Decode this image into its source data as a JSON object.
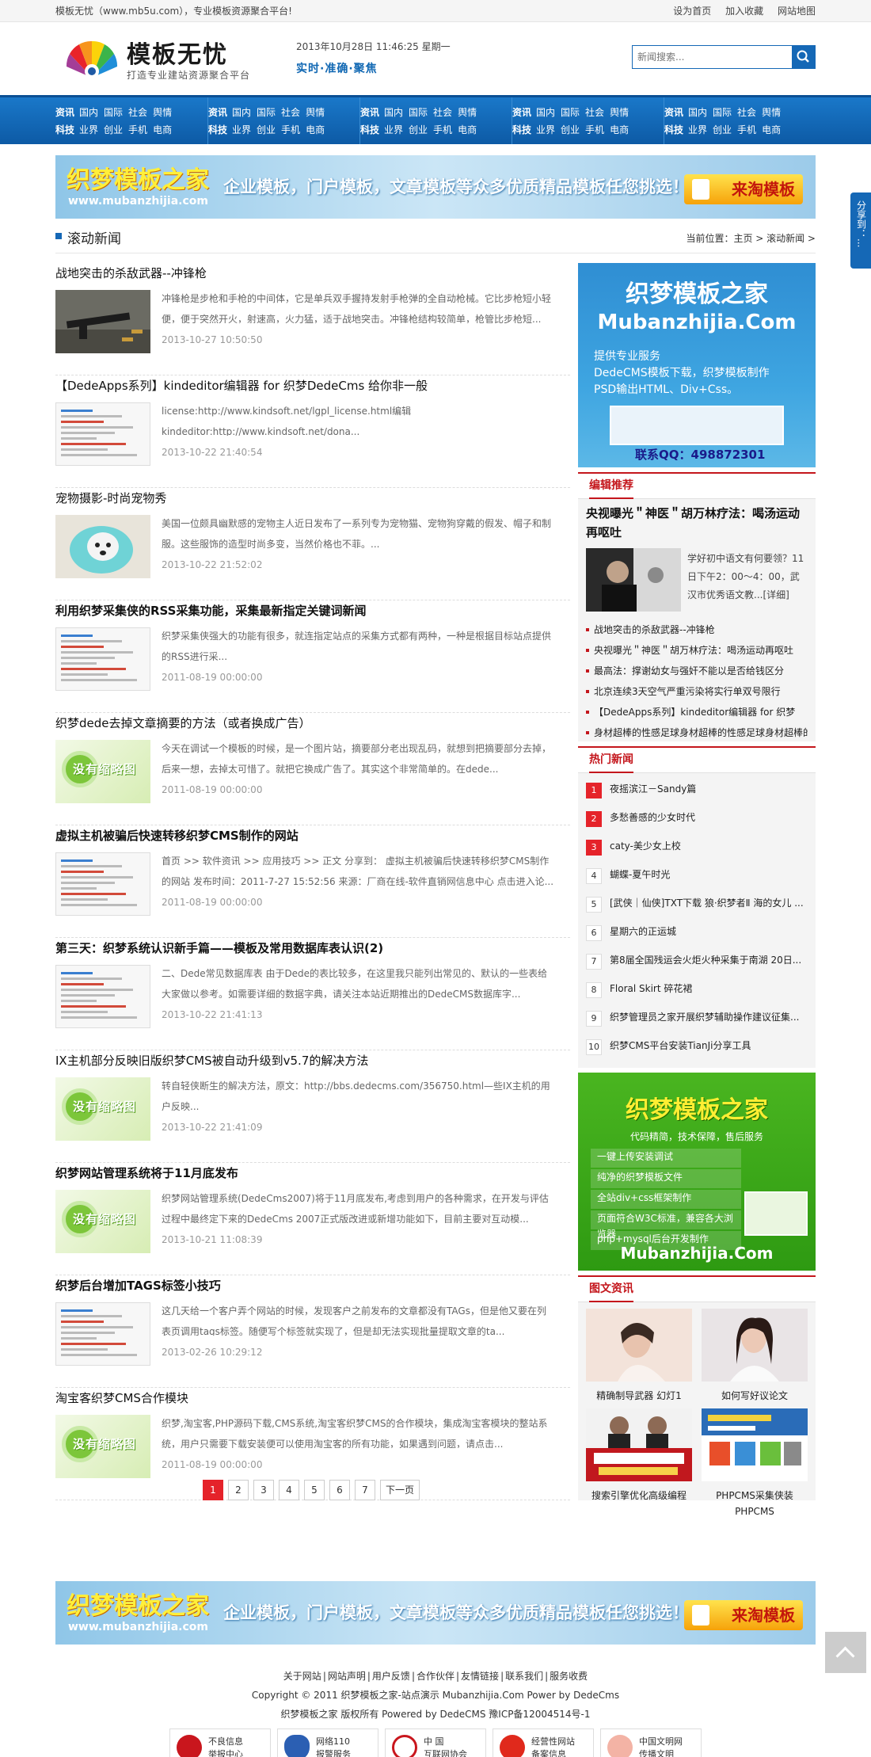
{
  "topbar": {
    "welcome": "模板无忧（www.mb5u.com），专业模板资源聚合平台!",
    "links": [
      "设为首页",
      "加入收藏",
      "网站地图"
    ]
  },
  "header": {
    "logo_name": "模板无忧",
    "logo_slogan": "打造专业建站资源聚合平台",
    "date": "2013年10月28日 11:46:25 星期一",
    "motto": "实时·准确·聚焦",
    "search_placeholder": "新闻搜索..."
  },
  "nav": {
    "columns": [
      {
        "row1_title": "资讯",
        "row1": [
          "国内",
          "国际",
          "社会",
          "舆情"
        ],
        "row2_title": "科技",
        "row2": [
          "业界",
          "创业",
          "手机",
          "电商"
        ]
      },
      {
        "row1_title": "资讯",
        "row1": [
          "国内",
          "国际",
          "社会",
          "舆情"
        ],
        "row2_title": "科技",
        "row2": [
          "业界",
          "创业",
          "手机",
          "电商"
        ]
      },
      {
        "row1_title": "资讯",
        "row1": [
          "国内",
          "国际",
          "社会",
          "舆情"
        ],
        "row2_title": "科技",
        "row2": [
          "业界",
          "创业",
          "手机",
          "电商"
        ]
      },
      {
        "row1_title": "资讯",
        "row1": [
          "国内",
          "国际",
          "社会",
          "舆情"
        ],
        "row2_title": "科技",
        "row2": [
          "业界",
          "创业",
          "手机",
          "电商"
        ]
      },
      {
        "row1_title": "资讯",
        "row1": [
          "国内",
          "国际",
          "社会",
          "舆情"
        ],
        "row2_title": "科技",
        "row2": [
          "业界",
          "创业",
          "手机",
          "电商"
        ]
      }
    ]
  },
  "banner": {
    "logo": "织梦模板之家",
    "url": "www.mubanzhijia.com",
    "text": "企业模板，门户模板，文章模板等众多优质精品模板任您挑选！",
    "button": "来淘模板"
  },
  "crumb": {
    "title": "滚动新闻",
    "position": "当前位置：主页 > 滚动新闻 >"
  },
  "articles": [
    {
      "title": "战地突击的杀敌武器--冲锋枪",
      "desc": "冲锋枪是步枪和手枪的中间体，它是单兵双手握持发射手枪弹的全自动枪械。它比步枪短小轻便，便于突然开火，射速高，火力猛，适于战地突击。冲锋枪结构较简单，枪管比步枪短...",
      "date": "2013-10-27 10:50:50",
      "thumb": "gun"
    },
    {
      "title": "【DedeApps系列】kindeditor编辑器 for 织梦DedeCms 给你非一般",
      "desc": "license:http://www.kindsoft.net/lgpl_license.html编辑 kindeditor:http://www.kindsoft.net/dona...",
      "date": "2013-10-22 21:40:54",
      "thumb": "shot"
    },
    {
      "title": "宠物摄影-时尚宠物秀",
      "desc": "美国一位颇具幽默感的宠物主人近日发布了一系列专为宠物猫、宠物狗穿戴的假发、帽子和制服。这些服饰的造型时尚多变，当然价格也不菲。...",
      "date": "2013-10-22 21:52:02",
      "thumb": "dog"
    },
    {
      "title": "利用织梦采集侠的RSS采集功能，采集最新指定关键词新闻",
      "desc": "织梦采集侠强大的功能有很多，就连指定站点的采集方式都有两种，一种是根据目标站点提供的RSS进行采...",
      "date": "2011-08-19 00:00:00",
      "thumb": "shot"
    },
    {
      "title": "织梦dede去掉文章摘要的方法（或者换成广告）",
      "desc": "今天在调试一个模板的时候，是一个图片站，摘要部分老出现乱码，就想到把摘要部分去掉，后来一想，去掉太可惜了。就把它换成广告了。其实这个非常简单的。在dede...",
      "date": "2011-08-19 00:00:00",
      "thumb": "noimg"
    },
    {
      "title": "虚拟主机被骗后快速转移织梦CMS制作的网站",
      "desc": "首页 >> 软件资讯 >> 应用技巧 >> 正文 分享到： 虚拟主机被骗后快速转移织梦CMS制作的网站 发布时间：2011-7-27 15:52:56 来源：厂商在线-软件直销网信息中心 点击进入论...",
      "date": "2011-08-19 00:00:00",
      "thumb": "shot"
    },
    {
      "title": "第三天：织梦系统认识新手篇——模板及常用数据库表认识(2)",
      "desc": "二、Dede常见数据库表 由于Dede的表比较多，在这里我只能列出常见的、默认的一些表给大家做以参考。如需要详细的数据字典，请关注本站近期推出的DedeCMS数据库字...",
      "date": "2013-10-22 21:41:13",
      "thumb": "shot"
    },
    {
      "title": "IX主机部分反映旧版织梦CMS被自动升级到v5.7的解决方法",
      "desc": "转自轻侠断生的解决方法，原文：http://bbs.dedecms.com/356750.html—些IX主机的用户反映...",
      "date": "2013-10-22 21:41:09",
      "thumb": "noimg"
    },
    {
      "title": "织梦网站管理系统将于11月底发布",
      "desc": "织梦网站管理系统(DedeCms2007)将于11月底发布,考虑到用户的各种需求，在开发与评估过程中最终定下来的DedeCms 2007正式版改进或新增功能如下，目前主要对互动模...",
      "date": "2013-10-21 11:08:39",
      "thumb": "noimg"
    },
    {
      "title": "织梦后台增加TAGS标签小技巧",
      "desc": "这几天给一个客户弄个网站的时候，发现客户之前发布的文章都没有TAGs，但是他又要在列表页调用tags标签。随便写个标签就实现了，但是却无法实现批量提取文章的ta...",
      "date": "2013-02-26 10:29:12",
      "thumb": "shot"
    },
    {
      "title": "淘宝客织梦CMS合作模块",
      "desc": "织梦,淘宝客,PHP源码下载,CMS系统,淘宝客织梦CMS的合作模块，集成淘宝客模块的整站系统，用户只需要下载安装便可以使用淘宝客的所有功能，如果遇到问题，请点击...",
      "date": "2011-08-19 00:00:00",
      "thumb": "noimg"
    }
  ],
  "noimg_text": "没有缩略图",
  "pager": {
    "pages": [
      "1",
      "2",
      "3",
      "4",
      "5",
      "6",
      "7"
    ],
    "next": "下一页"
  },
  "side_ad1": {
    "title": "织梦模板之家",
    "domain": "Mubanzhijia.Com",
    "lines": [
      "提供专业服务",
      "DedeCMS模板下载，织梦模板制作",
      "PSD输出HTML、Div+Css。"
    ],
    "qq": "联系QQ：498872301"
  },
  "editor": {
    "title": "编辑推荐",
    "headline": "央视曝光＂神医＂胡万林疗法：喝汤运动再呕吐",
    "pic_desc": "学好初中语文有何要领？11日下午2：00～4：00，武汉市优秀语文教...[详细]",
    "items": [
      "战地突击的杀敌武器--冲锋枪",
      "央视曝光＂神医＂胡万林疗法：喝汤运动再呕吐",
      "最高法：撑谢幼女与强奸不能以是否给钱区分",
      "北京连续3天空气严重污染将实行单双号限行",
      "【DedeApps系列】kindeditor编辑器 for 织梦",
      "身材超棒的性感足球身材超棒的性感足球身材超棒的"
    ]
  },
  "hot": {
    "title": "热门新闻",
    "items": [
      "夜摇滨江－Sandy篇",
      "多愁善感的少女时代",
      "caty-美少女上校",
      "蝴蝶-夏午时光",
      "[武侠｜仙侠]TXT下载 狼·织梦者Ⅱ 海的女儿 ...",
      "星期六的正运城",
      "第8届全国残运会火炬火种采集于南湖 20日...",
      "Floral Skirt 碎花裙",
      "织梦管理员之家开展织梦辅助操作建议征集...",
      "织梦CMS平台安装TianJi分享工具"
    ]
  },
  "side_ad2": {
    "title": "织梦模板之家",
    "tag": "代码精简，技术保障，售后服务",
    "items": [
      "一键上传安装调试",
      "纯净的织梦模板文件",
      "全站div+css框架制作",
      "页面符合W3C标准，兼容各大浏览器",
      "php+mysql后台开发制作"
    ],
    "domain": "Mubanzhijia.Com"
  },
  "photo": {
    "title": "图文资讯",
    "items": [
      {
        "caption": "精确制导武器 幻灯1"
      },
      {
        "caption": "如何写好议论文"
      },
      {
        "caption": "搜索引擎优化高级编程"
      },
      {
        "caption": "PHPCMS采集侠装"
      },
      {
        "caption": "PHPCMS"
      }
    ]
  },
  "share": {
    "label": "分享到：..."
  },
  "footer": {
    "links": [
      "关于网站",
      "网站声明",
      "用户反馈",
      "合作伙伴",
      "友情链接",
      "联系我们",
      "服务收费"
    ],
    "copyright": "Copyright © 2011 织梦模板之家-站点演示 Mubanzhijia.Com Power by DedeCms",
    "icp": "织梦模板之家 版权所有 Powered by DedeCMS 豫ICP备12004514号-1",
    "badges": [
      {
        "l1": "不良信息",
        "l2": "举报中心"
      },
      {
        "l1": "网络110",
        "l2": "报警服务"
      },
      {
        "l1": "中 国",
        "l2": "互联网协会"
      },
      {
        "l1": "经营性网站",
        "l2": "备案信息"
      },
      {
        "l1": "中国文明网",
        "l2": "传播文明"
      }
    ]
  },
  "colors": {
    "brand_blue": "#1568b6",
    "accent_red": "#c4161c",
    "page_red": "#e5232a"
  }
}
